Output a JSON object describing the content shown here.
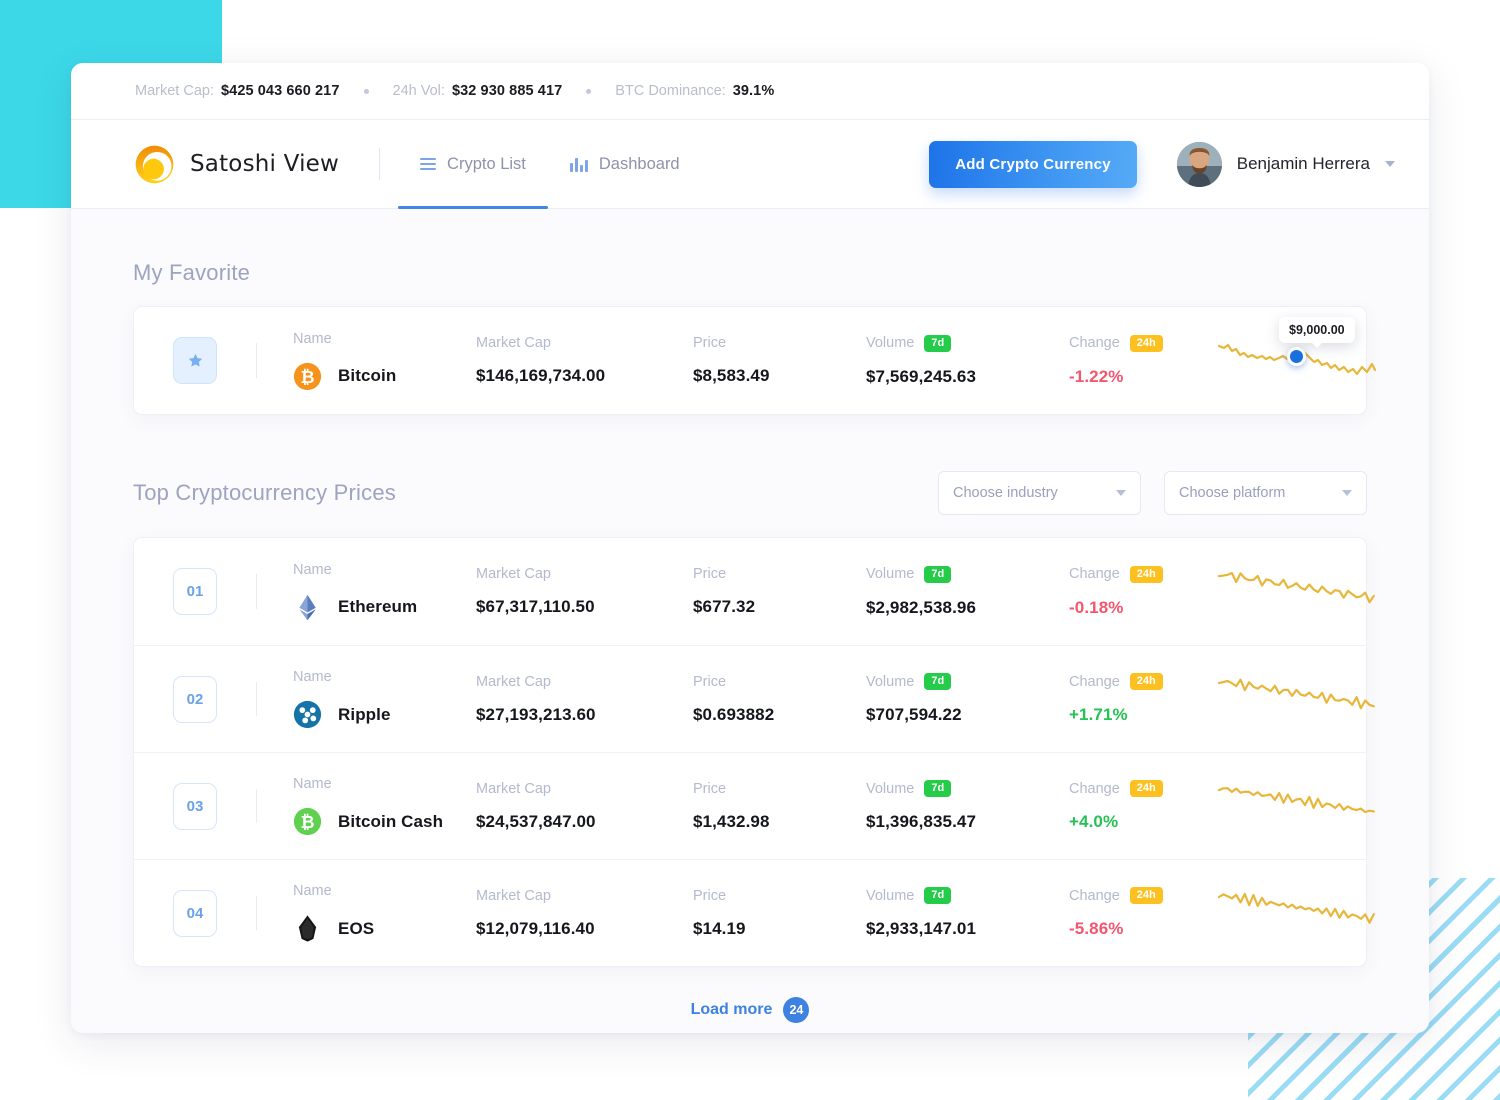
{
  "ticker": {
    "items": [
      {
        "label": "Market Cap:",
        "value": "$425 043 660 217"
      },
      {
        "label": "24h Vol:",
        "value": "$32 930 885 417"
      },
      {
        "label": "BTC Dominance:",
        "value": "39.1%"
      }
    ]
  },
  "header": {
    "brand_name": "Satoshi View",
    "nav": [
      {
        "label": "Crypto List",
        "icon": "list-icon",
        "active": true
      },
      {
        "label": "Dashboard",
        "icon": "bar-chart-icon",
        "active": false
      }
    ],
    "add_button": "Add Crypto Currency",
    "user_name": "Benjamin Herrera"
  },
  "favorite": {
    "title": "My Favorite",
    "columns": [
      "Name",
      "Market Cap",
      "Price",
      "Volume",
      "Change"
    ],
    "volume_tag": "7d",
    "change_tag": "24h",
    "row": {
      "name": "Bitcoin",
      "icon": "bitcoin-icon",
      "market_cap": "$146,169,734.00",
      "price": "$8,583.49",
      "volume": "$7,569,245.63",
      "change": "-1.22%",
      "change_dir": "neg",
      "tooltip": "$9,000.00"
    }
  },
  "top": {
    "title": "Top Cryptocurrency Prices",
    "select_industry": "Choose industry",
    "select_platform": "Choose platform",
    "columns": [
      "Name",
      "Market Cap",
      "Price",
      "Volume",
      "Change"
    ],
    "volume_tag": "7d",
    "change_tag": "24h",
    "rows": [
      {
        "rank": "01",
        "name": "Ethereum",
        "icon": "ethereum-icon",
        "market_cap": "$67,317,110.50",
        "price": "$677.32",
        "volume": "$2,982,538.96",
        "change": "-0.18%",
        "change_dir": "neg"
      },
      {
        "rank": "02",
        "name": "Ripple",
        "icon": "ripple-icon",
        "market_cap": "$27,193,213.60",
        "price": "$0.693882",
        "volume": "$707,594.22",
        "change": "+1.71%",
        "change_dir": "pos"
      },
      {
        "rank": "03",
        "name": "Bitcoin Cash",
        "icon": "bitcoin-cash-icon",
        "market_cap": "$24,537,847.00",
        "price": "$1,432.98",
        "volume": "$1,396,835.47",
        "change": "+4.0%",
        "change_dir": "pos"
      },
      {
        "rank": "04",
        "name": "EOS",
        "icon": "eos-icon",
        "market_cap": "$12,079,116.40",
        "price": "$14.19",
        "volume": "$2,933,147.01",
        "change": "-5.86%",
        "change_dir": "neg"
      }
    ],
    "load_more_label": "Load more",
    "load_more_count": "24"
  },
  "colors": {
    "accent_blue": "#3d82e0",
    "tag_green": "#25cc4a",
    "tag_yellow": "#fcc120",
    "negative": "#f5566e",
    "positive": "#26c253",
    "spark_line": "#e8b63a",
    "deco_teal": "#3cd8e8",
    "deco_stripe": "#9adcf6"
  }
}
